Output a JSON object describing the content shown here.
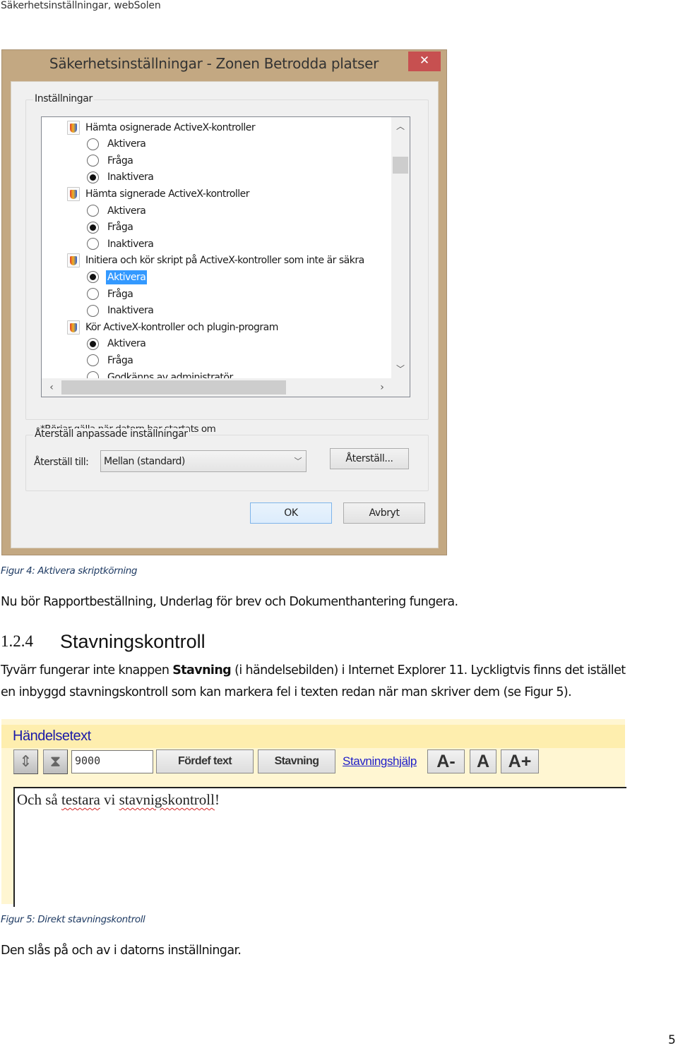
{
  "page": {
    "running_head": "Säkerhetsinställningar, webSolen",
    "page_number": "5"
  },
  "figure4": {
    "window_title": "Säkerhetsinställningar - Zonen Betrodda platser",
    "close_icon": "close-icon",
    "settings_group_label": "Inställningar",
    "settings": [
      {
        "label": "Hämta osignerade ActiveX-kontroller",
        "icon": "security-shield-icon",
        "options": [
          {
            "label": "Aktivera",
            "checked": false,
            "selected": false
          },
          {
            "label": "Fråga",
            "checked": false,
            "selected": false
          },
          {
            "label": "Inaktivera",
            "checked": true,
            "selected": false
          }
        ]
      },
      {
        "label": "Hämta signerade ActiveX-kontroller",
        "icon": "security-shield-icon",
        "options": [
          {
            "label": "Aktivera",
            "checked": false,
            "selected": false
          },
          {
            "label": "Fråga",
            "checked": true,
            "selected": false
          },
          {
            "label": "Inaktivera",
            "checked": false,
            "selected": false
          }
        ]
      },
      {
        "label": "Initiera och kör skript på ActiveX-kontroller som inte är säkra",
        "icon": "security-shield-icon",
        "options": [
          {
            "label": "Aktivera",
            "checked": true,
            "selected": true
          },
          {
            "label": "Fråga",
            "checked": false,
            "selected": false
          },
          {
            "label": "Inaktivera",
            "checked": false,
            "selected": false
          }
        ]
      },
      {
        "label": "Kör ActiveX-kontroller och plugin-program",
        "icon": "security-shield-icon",
        "options": [
          {
            "label": "Aktivera",
            "checked": true,
            "selected": false
          },
          {
            "label": "Fråga",
            "checked": false,
            "selected": false
          },
          {
            "label": "Godkänns av administratör",
            "checked": false,
            "selected": false
          }
        ]
      }
    ],
    "restart_note": "*Börjar gälla när datorn har startats om",
    "reset_group_label": "Återställ anpassade inställningar",
    "reset_to_label": "Återställ till:",
    "reset_to_value": "Mellan (standard)",
    "reset_button": "Återställ...",
    "ok_button": "OK",
    "cancel_button": "Avbryt",
    "colors": {
      "frame": "#c3a882",
      "close": "#c75050",
      "selection": "#3399ff"
    }
  },
  "figure4_caption": "Figur 4: Aktivera skriptkörning",
  "paragraph1": "Nu bör Rapportbeställning, Underlag för brev och Dokumenthantering fungera.",
  "section": {
    "number": "1.2.4",
    "title": "Stavningskontroll"
  },
  "paragraph2": {
    "line1_before": "Tyvärr fungerar inte knappen ",
    "line1_bold": "Stavning",
    "line1_after": " (i händelsebilden) i Internet Explorer 11. Lyckligtvis finns det istället",
    "line2": "en inbyggd stavningskontroll som kan markera fel i texten redan när man skriver dem (se Figur 5)."
  },
  "figure5": {
    "title": "Händelsetext",
    "expand_icon": "expand-arrows-icon",
    "collapse_icon": "collapse-arrows-icon",
    "char_limit_value": "9000",
    "predefined_text_button": "Fördef text",
    "spelling_button": "Stavning",
    "spelling_help_link": "Stavningshjälp",
    "font_smaller_button": "A-",
    "font_normal_button": "A",
    "font_larger_button": "A+",
    "editor_text": {
      "w1": "Och så ",
      "w2": "testara",
      "w3": " vi ",
      "w4": "stavnigskontroll",
      "w5": "!"
    },
    "colors": {
      "panel": "#fff6d2",
      "header": "#feeeae",
      "title": "#1a1aa8",
      "link": "#2020c8",
      "spell_error": "#d42020"
    }
  },
  "figure5_caption": "Figur 5: Direkt stavningskontroll",
  "paragraph3": "Den slås på och av i datorns inställningar."
}
